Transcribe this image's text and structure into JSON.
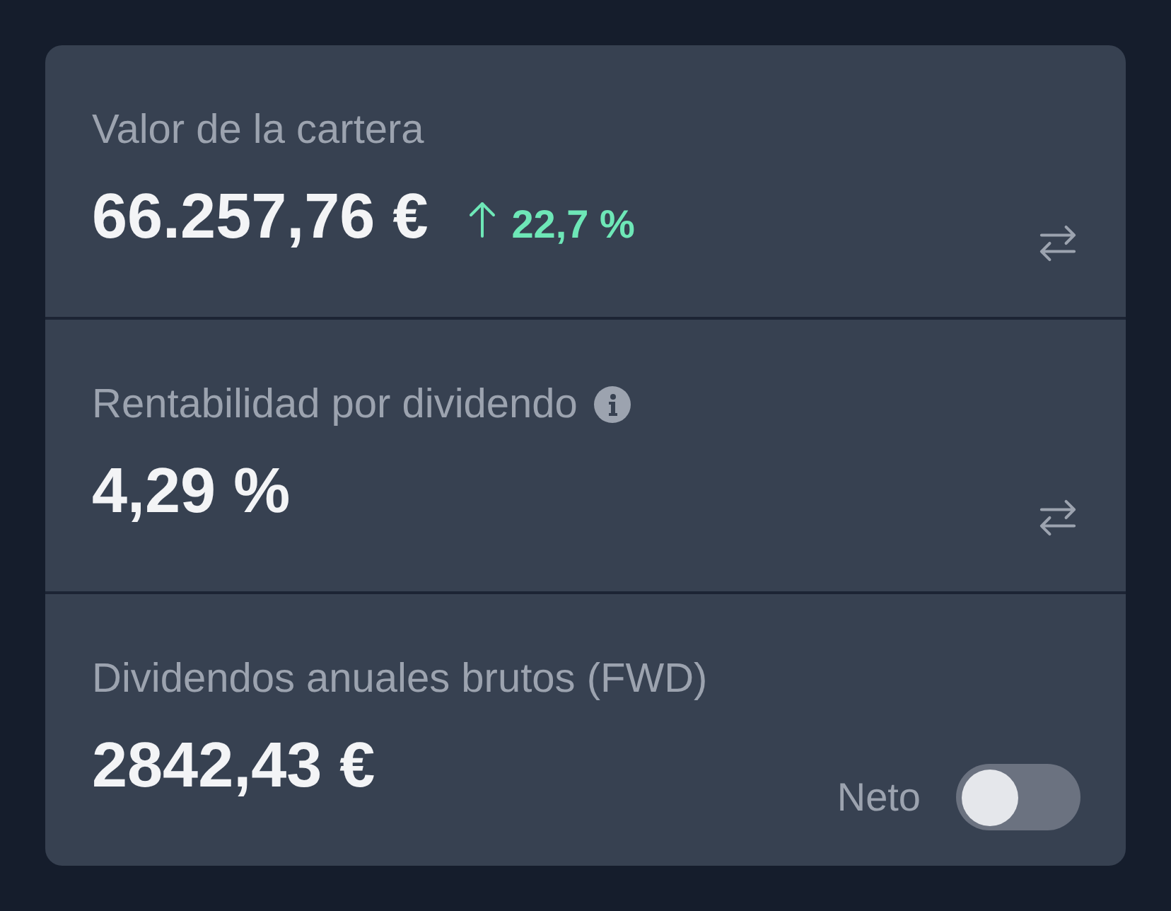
{
  "cards": [
    {
      "label": "Valor de la cartera",
      "info": false,
      "value": "66.257,76 €",
      "change": {
        "kind": "up",
        "text": "22,7 %"
      },
      "control": {
        "kind": "swap"
      }
    },
    {
      "label": "Rentabilidad por dividendo",
      "info": true,
      "value": "4,29 %",
      "control": {
        "kind": "swap"
      }
    },
    {
      "label": "Dividendos anuales brutos (FWD)",
      "info": false,
      "value": "2842,43 €",
      "control": {
        "kind": "switch",
        "label": "Neto",
        "checked": false
      }
    }
  ]
}
